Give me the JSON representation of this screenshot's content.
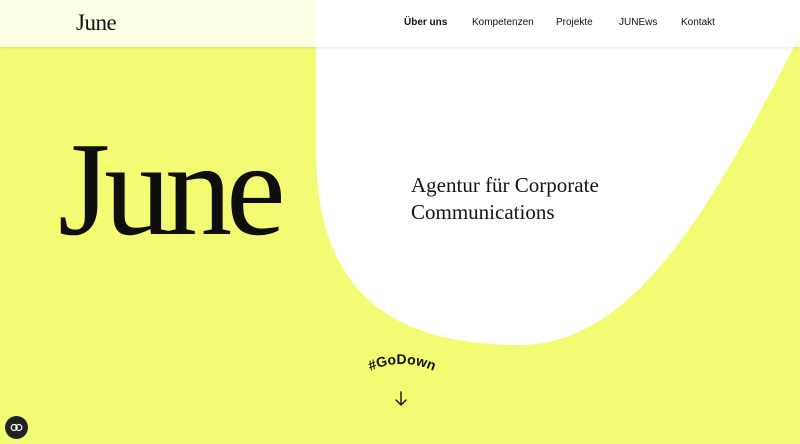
{
  "brand": {
    "logo_text": "June",
    "accent_color": "#f2fb72"
  },
  "nav": {
    "items": [
      {
        "label": "Über uns",
        "active": true
      },
      {
        "label": "Kompetenzen",
        "active": false
      },
      {
        "label": "Projekte",
        "active": false
      },
      {
        "label": "JUNEws",
        "active": false
      },
      {
        "label": "Kontakt",
        "active": false
      }
    ]
  },
  "hero": {
    "logo_text": "June",
    "tagline_line1": "Agentur für Corporate",
    "tagline_line2": "Communications",
    "hashtag": "#GoDown"
  },
  "icons": {
    "scroll": "arrow-down-icon",
    "cookie": "cookie-settings-icon"
  }
}
